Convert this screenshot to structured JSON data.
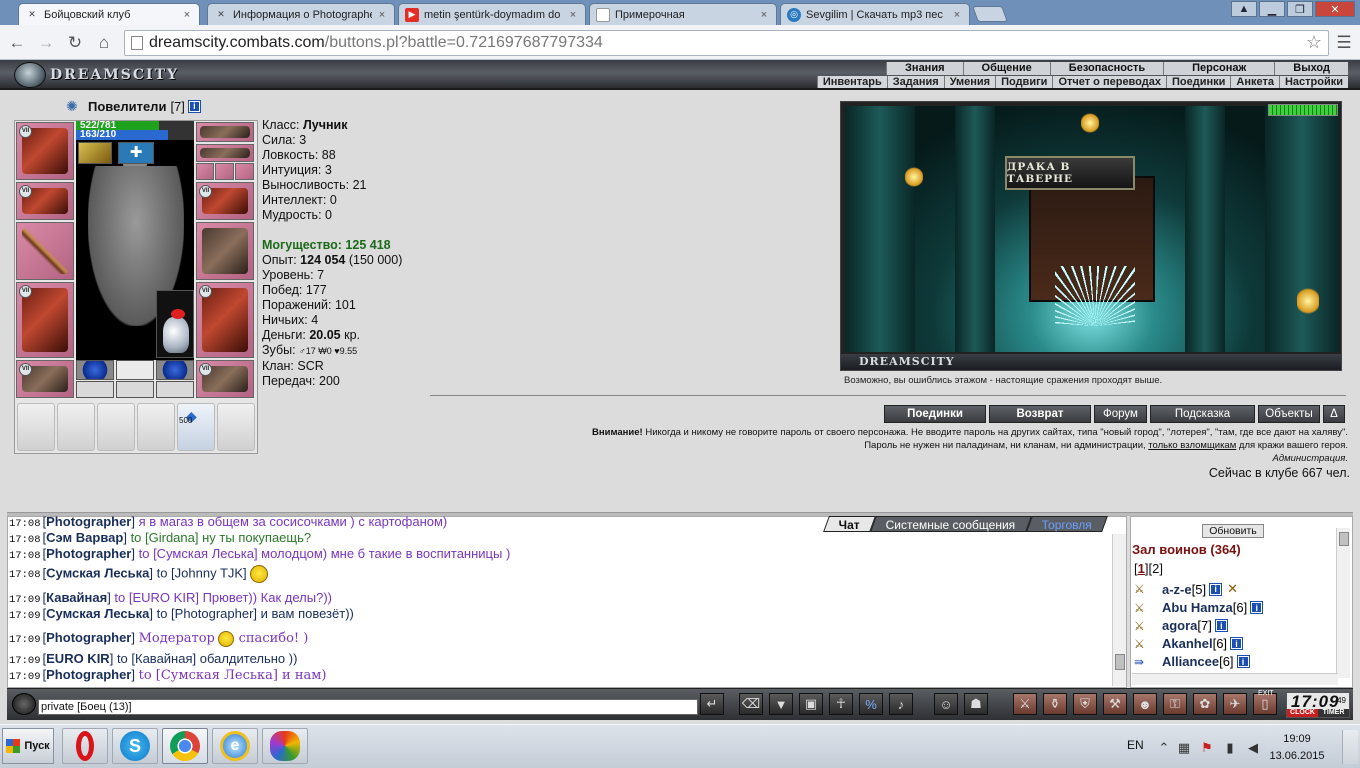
{
  "browser": {
    "tabs": [
      {
        "label": "Бойцовский клуб",
        "icon": "crossed-swords-icon",
        "active": true
      },
      {
        "label": "Информация о Photographe",
        "icon": "crossed-swords-icon",
        "active": false
      },
      {
        "label": "metin şentürk-doymadım do",
        "icon": "youtube-icon",
        "active": false
      },
      {
        "label": "Примерочная",
        "icon": "page-icon",
        "active": false
      },
      {
        "label": "Sevgilim | Скачать mp3 пес",
        "icon": "globe-icon",
        "active": false
      }
    ],
    "url_host": "dreamscity.combats.com",
    "url_path": "/buttons.pl?battle=0.721697687797334"
  },
  "game": {
    "logo_text": "DREAMSCITY",
    "topnav": [
      "Знания",
      "Общение",
      "Безопасность",
      "Персонаж",
      "Выход"
    ],
    "subnav": [
      "Инвентарь",
      "Задания",
      "Умения",
      "Подвиги",
      "Отчет о переводах",
      "Поединки",
      "Анкета",
      "Настройки"
    ],
    "character": {
      "clan_name": "Повелители",
      "level_tag": "[7]",
      "hp": "522/781",
      "mana": "163/210",
      "bag_count": "500",
      "stats": {
        "class_label": "Класс:",
        "class_value": "Лучник",
        "strength": "Сила: 3",
        "agility": "Ловкость: 88",
        "intuition": "Интуиция: 3",
        "endurance": "Выносливость: 21",
        "intellect": "Интеллект: 0",
        "wisdom": "Мудрость: 0",
        "power_label": "Могущество:",
        "power_value": "125 418",
        "exp_label": "Опыт:",
        "exp_value": "124 054",
        "exp_next": "(150 000)",
        "level": "Уровень: 7",
        "wins": "Побед: 177",
        "losses": "Поражений: 101",
        "draws": "Ничьих: 4",
        "money_label": "Деньги:",
        "money_value": "20.05",
        "money_unit": "кр.",
        "teeth_label": "Зубы:",
        "teeth_value": "♂17 ₩0 ♥9.55",
        "clan": "Клан: SCR",
        "transfers": "Передач: 200"
      }
    },
    "scene": {
      "sign": "ДРАКА В ТАВЕРНЕ",
      "caption": "DREAMSCITY",
      "floor_note": "Возможно, вы ошиблись этажом - настоящие сражения проходят выше."
    },
    "actions": [
      "Поединки",
      "Возврат",
      "Форум",
      "Подсказка",
      "Объекты",
      "Δ"
    ],
    "warning": {
      "bold": "Внимание!",
      "line1": " Никогда и никому не говорите пароль от своего персонажа. Не вводите пароль на других сайтах, типа \"новый город\", \"лотерея\", \"там, где все дают на халяву\".",
      "line2a": "Пароль не нужен ни паладинам, ни кланам, ни администрации, ",
      "line2link": "только взломщикам",
      "line2b": " для кражи вашего героя.",
      "sign": "Администрация."
    },
    "online": "Сейчас в клубе 667 чел."
  },
  "chat": {
    "tabs": [
      "Чат",
      "Системные сообщения",
      "Торговля"
    ],
    "lines": [
      {
        "time": "17:08",
        "from": "Photographer",
        "to": "",
        "text": "я в магаз в общем за сосисочками ) с картофаном)"
      },
      {
        "time": "17:08",
        "from": "Сэм Варвар",
        "to": "to [Girdana]",
        "text": " ну ты покупаещь?"
      },
      {
        "time": "17:08",
        "from": "Photographer",
        "to": "to [Сумская Леська]",
        "text": " молодцом) мне б такие в воспитанницы )"
      },
      {
        "time": "17:08",
        "from": "Сумская Леська",
        "to": "to [Johnny TJK]",
        "text": ""
      },
      {
        "time": "17:09",
        "from": "Кавайная",
        "to": "to [EURO KIR]",
        "text": " Прювет)) Как делы?))"
      },
      {
        "time": "17:09",
        "from": "Сумская Леська",
        "to": "to [Photographer]",
        "text": " и вам повезёт))"
      },
      {
        "time": "17:09",
        "from": "Photographer",
        "to": "Модератор",
        "text": " спасибо! )"
      },
      {
        "time": "17:09",
        "from": "EURO KIR",
        "to": "to [Кавайная]",
        "text": " обалдительно ))"
      },
      {
        "time": "17:09",
        "from": "Photographer",
        "to": "to [Сумская Леська]",
        "text": " и нам)"
      }
    ],
    "input_value": "private [Боец (13)]"
  },
  "players": {
    "refresh": "Обновить",
    "hall": "Зал воинов (364)",
    "pages_open": "[",
    "page1": "1",
    "pages_mid": "][2]",
    "list": [
      {
        "name": "a-z-e",
        "level": "[5]"
      },
      {
        "name": "Abu Hamza",
        "level": "[6]"
      },
      {
        "name": "agora",
        "level": "[7]"
      },
      {
        "name": "Akanhel",
        "level": "[6]"
      },
      {
        "name": "Alliancee",
        "level": "[6]"
      }
    ]
  },
  "clock": {
    "time": "17:09",
    "seconds": "49",
    "clock_label": "CLOCK",
    "timer_label": "TIMER",
    "exit_label": "EXIT"
  },
  "taskbar": {
    "start": "Пуск",
    "lang": "EN",
    "time": "19:09",
    "date": "13.06.2015"
  }
}
